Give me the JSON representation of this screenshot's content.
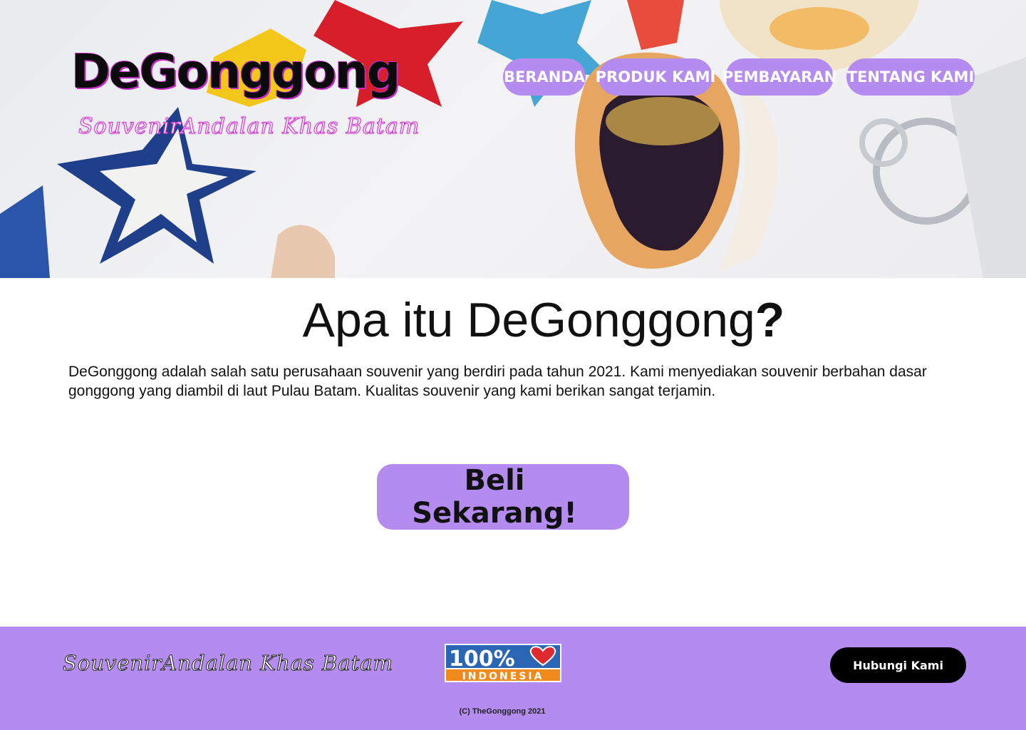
{
  "header": {
    "brand": "DeGonggong",
    "tagline": "SouvenirAndalan Khas Batam",
    "nav": [
      "BERANDA",
      "PRODUK KAMI",
      "PEMBAYARAN",
      "TENTANG KAMI"
    ]
  },
  "main": {
    "title": "Apa itu DeGonggong",
    "title_mark": "?",
    "intro": "DeGonggong adalah salah satu perusahaan souvenir yang berdiri pada tahun 2021. Kami menyediakan souvenir berbahan dasar gonggong yang diambil di laut Pulau Batam. Kualitas souvenir yang kami berikan sangat terjamin.",
    "cta": "Beli Sekarang!"
  },
  "footer": {
    "tagline": "SouvenirAndalan Khas Batam",
    "badge_top": "100%",
    "badge_bottom": "INDONESIA",
    "contact": "Hubungi Kami",
    "copyright": "(C) TheGonggong 2021"
  },
  "colors": {
    "accent": "#b48cf0",
    "brand_glow": "#c42cc6",
    "contact_bg": "#000000"
  },
  "icons": [
    "heart-icon"
  ]
}
